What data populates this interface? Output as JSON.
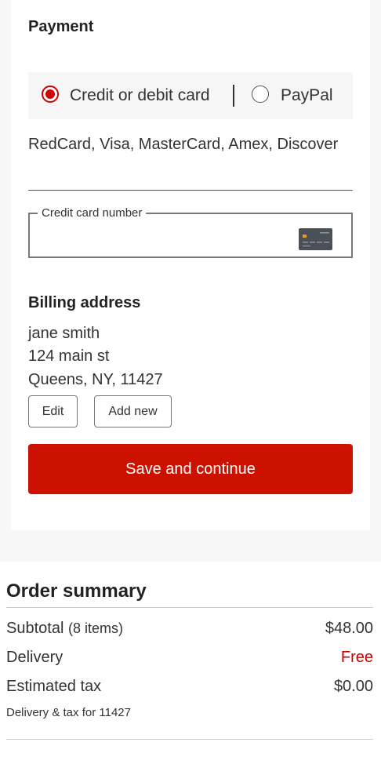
{
  "payment": {
    "title": "Payment",
    "methods": [
      {
        "label": "Credit or debit card",
        "selected": true
      },
      {
        "label": "PayPal",
        "selected": false
      }
    ],
    "accepted_cards": "RedCard, Visa, MasterCard, Amex, Discover",
    "card_number_label": "Credit card number",
    "card_number_value": ""
  },
  "billing": {
    "title": "Billing address",
    "name": "jane smith",
    "street": "124 main st",
    "city_line": "Queens, NY, 11427",
    "edit_label": "Edit",
    "add_new_label": "Add new"
  },
  "actions": {
    "save_label": "Save and continue"
  },
  "summary": {
    "title": "Order summary",
    "subtotal_label": "Subtotal",
    "subtotal_count": "(8 items)",
    "subtotal_value": "$48.00",
    "delivery_label": "Delivery",
    "delivery_value": "Free",
    "tax_label": "Estimated tax",
    "tax_value": "$0.00",
    "note": "Delivery & tax for 11427"
  },
  "colors": {
    "accent": "#cc1100",
    "selected_radio": "#cc0000",
    "free_text": "#cc0000"
  },
  "icons": {
    "card_icon": "credit-card-icon"
  }
}
